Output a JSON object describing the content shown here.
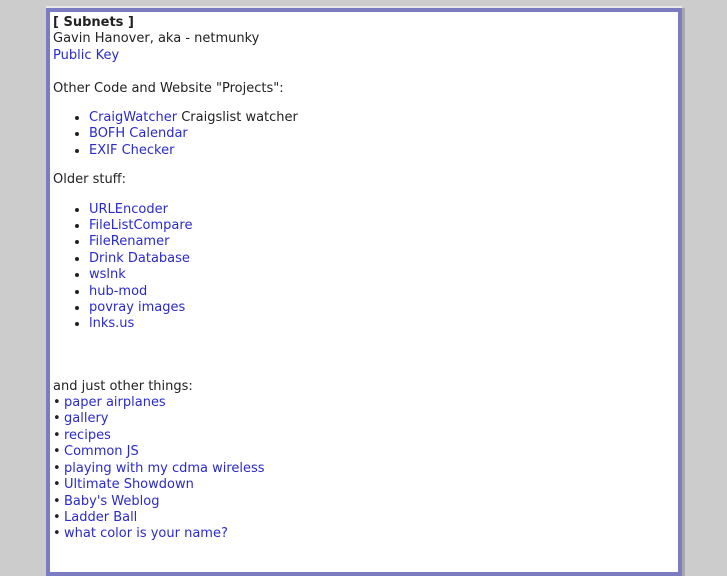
{
  "header": {
    "title": "[ Subnets ]",
    "author": "Gavin Hanover, aka - netmunky",
    "public_key": "Public Key"
  },
  "projects": {
    "heading": "Other Code and Website \"Projects\":",
    "items": [
      {
        "label": "CraigWatcher",
        "desc": " Craigslist watcher"
      },
      {
        "label": "BOFH Calendar"
      },
      {
        "label": "EXIF Checker"
      }
    ]
  },
  "older": {
    "heading": "Older stuff:",
    "items": [
      "URLEncoder",
      "FileListCompare",
      "FileRenamer",
      "Drink Database",
      "wslnk",
      "hub-mod",
      "povray images",
      "lnks.us"
    ]
  },
  "other": {
    "heading": "and just other things:",
    "items": [
      "paper airplanes",
      "gallery",
      "recipes",
      "Common JS",
      "playing with my cdma wireless",
      "Ultimate Showdown",
      "Baby's Weblog",
      "Ladder Ball",
      "what color is your name?"
    ]
  }
}
